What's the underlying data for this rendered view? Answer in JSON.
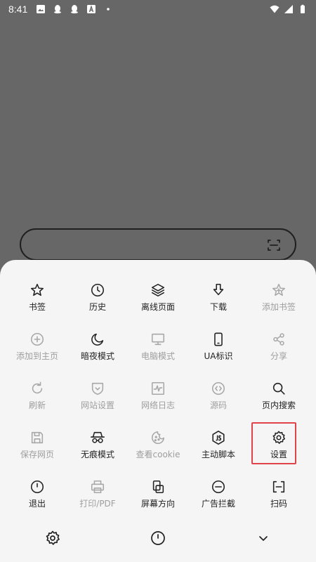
{
  "status_bar": {
    "time": "8:41",
    "left_icons": [
      "image-icon",
      "qq-icon",
      "qq-icon",
      "a-box-icon",
      "dot-icon"
    ],
    "right_icons": [
      "wifi-icon",
      "signal-icon",
      "battery-icon"
    ]
  },
  "search_bar": {
    "icon": "scan-icon"
  },
  "menu": {
    "rows": [
      [
        {
          "label": "书签",
          "icon": "star-icon",
          "enabled": true
        },
        {
          "label": "历史",
          "icon": "clock-icon",
          "enabled": true
        },
        {
          "label": "离线页面",
          "icon": "layers-icon",
          "enabled": true
        },
        {
          "label": "下载",
          "icon": "download-icon",
          "enabled": true
        },
        {
          "label": "添加书签",
          "icon": "star-add-icon",
          "enabled": false
        }
      ],
      [
        {
          "label": "添加到主页",
          "icon": "plus-circle-icon",
          "enabled": false
        },
        {
          "label": "暗夜模式",
          "icon": "moon-icon",
          "enabled": true
        },
        {
          "label": "电脑模式",
          "icon": "monitor-icon",
          "enabled": false
        },
        {
          "label": "UA标识",
          "icon": "phone-icon",
          "enabled": true
        },
        {
          "label": "分享",
          "icon": "share-icon",
          "enabled": false
        }
      ],
      [
        {
          "label": "刷新",
          "icon": "refresh-icon",
          "enabled": false
        },
        {
          "label": "网站设置",
          "icon": "shield-icon",
          "enabled": false
        },
        {
          "label": "网络日志",
          "icon": "pulse-icon",
          "enabled": false
        },
        {
          "label": "源码",
          "icon": "code-icon",
          "enabled": false
        },
        {
          "label": "页内搜索",
          "icon": "search-icon",
          "enabled": true
        }
      ],
      [
        {
          "label": "保存网页",
          "icon": "save-icon",
          "enabled": false
        },
        {
          "label": "无痕模式",
          "icon": "incognito-icon",
          "enabled": true
        },
        {
          "label": "查看cookie",
          "icon": "cookie-icon",
          "enabled": false
        },
        {
          "label": "主动脚本",
          "icon": "js-icon",
          "enabled": true
        },
        {
          "label": "设置",
          "icon": "gear-icon",
          "enabled": true,
          "highlighted": true
        }
      ],
      [
        {
          "label": "退出",
          "icon": "power-icon",
          "enabled": true
        },
        {
          "label": "打印/PDF",
          "icon": "printer-icon",
          "enabled": false
        },
        {
          "label": "屏幕方向",
          "icon": "rotate-icon",
          "enabled": true
        },
        {
          "label": "广告拦截",
          "icon": "block-icon",
          "enabled": true
        },
        {
          "label": "扫码",
          "icon": "scan-icon",
          "enabled": true
        }
      ]
    ]
  },
  "bottom_bar": {
    "buttons": [
      "gear-icon",
      "power-icon",
      "chevron-down-icon"
    ]
  },
  "colors": {
    "backdrop": "#676767",
    "sheet": "#f5f5f5",
    "text_enabled": "#222222",
    "text_disabled": "#9e9e9e",
    "highlight_border": "#e0434a"
  }
}
